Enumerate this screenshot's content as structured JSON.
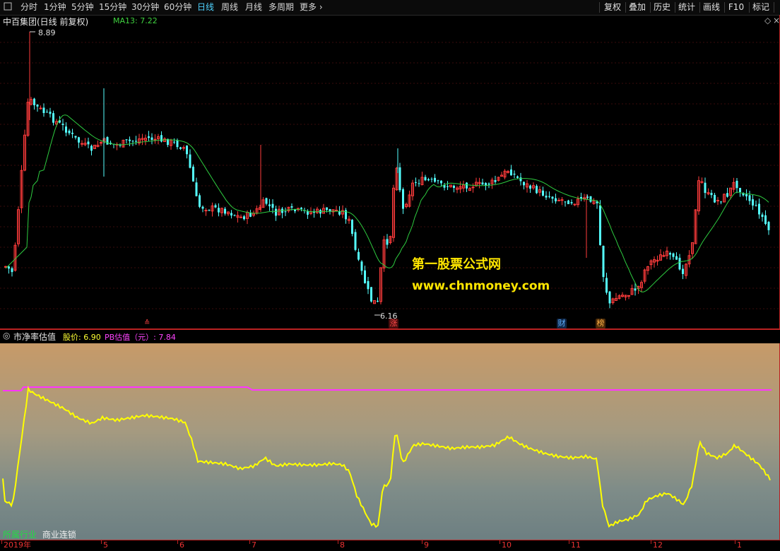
{
  "toolbar": {
    "periods": [
      {
        "label": "分时",
        "active": false
      },
      {
        "label": "1分钟",
        "active": false
      },
      {
        "label": "5分钟",
        "active": false
      },
      {
        "label": "15分钟",
        "active": false
      },
      {
        "label": "30分钟",
        "active": false
      },
      {
        "label": "60分钟",
        "active": false
      },
      {
        "label": "日线",
        "active": true
      },
      {
        "label": "周线",
        "active": false
      },
      {
        "label": "月线",
        "active": false
      },
      {
        "label": "多周期",
        "active": false
      },
      {
        "label": "更多",
        "active": false
      }
    ],
    "more_glyph": "›",
    "right_buttons": [
      "复权",
      "叠加",
      "历史",
      "统计",
      "画线",
      "F10",
      "标记"
    ]
  },
  "main_chart": {
    "title": "中百集团(日线 前复权)",
    "ma_label": "MA13: 7.22",
    "high_label": "8.89",
    "low_label": "6.16",
    "tags": [
      {
        "text": "涨",
        "color": "#ff4a4a",
        "bg": "#5a1010"
      },
      {
        "text": "财",
        "color": "#5fb0ff",
        "bg": "#102a4a"
      },
      {
        "text": "榜",
        "color": "#ffb347",
        "bg": "#4a2a08"
      }
    ],
    "event_marker": "≙"
  },
  "watermark": {
    "line1": "第一股票公式网",
    "line2": "www.chnmoney.com"
  },
  "indicator": {
    "name": "市净率估值",
    "price_label": "股价: 6.90",
    "pb_label": "PB估值（元）: 7.84",
    "industry_label": "所属行业",
    "industry_value": "商业连锁"
  },
  "x_axis": {
    "labels": [
      "2019年",
      "5",
      "6",
      "7",
      "8",
      "9",
      "10",
      "11",
      "12",
      "1"
    ]
  },
  "colors": {
    "up": "#ff3b3b",
    "down": "#54ffff",
    "ma": "#33cc33",
    "price_line": "#ffff00",
    "pb_line": "#ff33ff"
  },
  "chart_data": {
    "type": "candlestick",
    "series": [
      {
        "name": "MA13",
        "last": 7.22
      },
      {
        "name": "股价",
        "last": 6.9
      },
      {
        "name": "PB估值（元）",
        "last": 7.84
      }
    ],
    "price_high": 8.89,
    "price_low": 6.16
  }
}
